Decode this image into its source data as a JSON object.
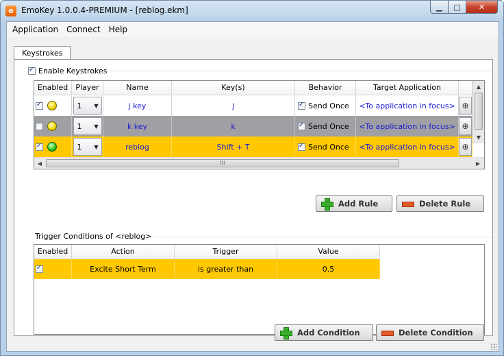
{
  "window": {
    "title": "EmoKey 1.0.0.4-PREMIUM - [reblog.ekm]",
    "icon": "emokey-app-icon",
    "buttons": {
      "minimize": "▁",
      "maximize": "□",
      "close": "✕"
    }
  },
  "menu": [
    "Application",
    "Connect",
    "Help"
  ],
  "tabs": [
    {
      "label": "Keystrokes",
      "active": true
    }
  ],
  "keystrokes": {
    "enable_label": "Enable Keystrokes",
    "enabled": true,
    "columns": [
      "Enabled",
      "Player",
      "Name",
      "Key(s)",
      "Behavior",
      "Target Application"
    ],
    "rows": [
      {
        "enabled": true,
        "status": "yellow",
        "player": "1",
        "name": "j key",
        "keys": "j",
        "send_once": true,
        "behavior": "Send Once",
        "target": "<To application in focus>",
        "style": "white"
      },
      {
        "enabled": false,
        "status": "yellow",
        "player": "1",
        "name": "k key",
        "keys": "k",
        "send_once": true,
        "behavior": "Send Once",
        "target": "<To application in focus>",
        "style": "gray"
      },
      {
        "enabled": true,
        "status": "green",
        "player": "1",
        "name": "reblog",
        "keys": "Shift + T",
        "send_once": true,
        "behavior": "Send Once",
        "target": "<To application in focus>",
        "style": "yellow"
      }
    ],
    "hscroll_glyph": "III",
    "buttons": {
      "add_rule": "Add Rule",
      "delete_rule": "Delete Rule"
    }
  },
  "trigger": {
    "label": "Trigger Conditions of <reblog>",
    "columns": [
      "Enabled",
      "Action",
      "Trigger",
      "Value"
    ],
    "rows": [
      {
        "enabled": true,
        "action": "Excite Short Term",
        "trigger": "is greater than",
        "value": "0.5"
      }
    ],
    "buttons": {
      "add_condition": "Add Condition",
      "delete_condition": "Delete Condition"
    }
  },
  "colors": {
    "selected_row": "#ffc800",
    "disabled_row": "#a0a0a4",
    "link_text": "#1a1ad4"
  }
}
